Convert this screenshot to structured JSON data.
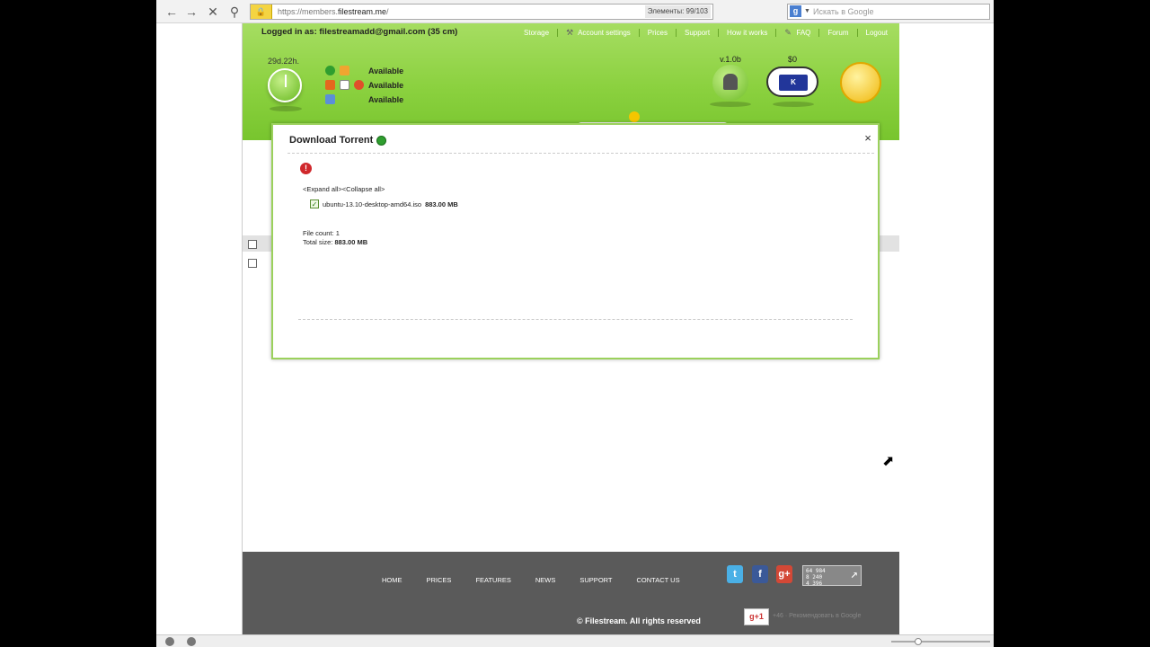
{
  "browser": {
    "url_prefix": "https://members.",
    "url_domain": "filestream.me",
    "url_suffix": "/",
    "elements_count": "Элементы: 99/103",
    "search_placeholder": "Искать в Google",
    "back_icon": "back-arrow-icon",
    "forward_icon": "forward-arrow-icon",
    "stop_icon": "close-icon",
    "key_icon": "key-icon"
  },
  "header": {
    "logged_in_label": "Logged in as: filestreamadd@gmail.com (35 cm)",
    "nav": {
      "storage": "Storage",
      "account_settings": "Account settings",
      "prices": "Prices",
      "support": "Support",
      "how_it_works": "How it works",
      "faq": "FAQ",
      "forum": "Forum",
      "logout": "Logout"
    },
    "timer": "29d.22h.",
    "services": [
      {
        "status": "Available"
      },
      {
        "status": "Available"
      },
      {
        "status": "Available"
      }
    ],
    "android_version": "v.1.0b",
    "balance": "$0"
  },
  "modal": {
    "title": "Download Torrent",
    "expand_all": "<Expand all>",
    "collapse_all": "<Collapse all>",
    "file_name": "ubuntu-13.10-desktop-amd64.iso",
    "file_size": "883.00 MB",
    "file_count_label": "File count: ",
    "file_count": "1",
    "total_size_label": "Total size: ",
    "total_size": "883.00 MB",
    "close_symbol": "×"
  },
  "footer": {
    "links": {
      "home": "HOME",
      "prices": "PRICES",
      "features": "FEATURES",
      "news": "NEWS",
      "support": "SUPPORT",
      "contact_us": "CONTACT US"
    },
    "counter": [
      "64 984",
      "8 240",
      "4 396"
    ],
    "copyright": "© Filestream. All rights reserved",
    "gplus_label": "g+1",
    "gplus_text": "+46 · Рекомендовать в Google"
  },
  "colors": {
    "header_green": "#8bd13f",
    "modal_border": "#9bd15c",
    "footer_grey": "#5a5a5a"
  }
}
